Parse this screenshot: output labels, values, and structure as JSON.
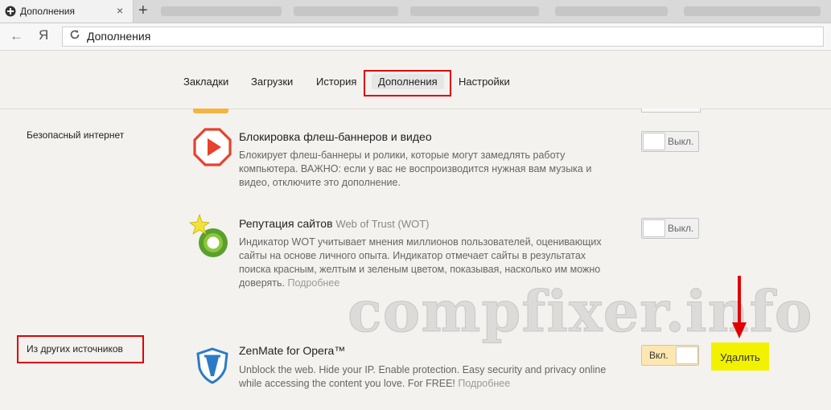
{
  "tab": {
    "title": "Дополнения",
    "close": "×",
    "new_tab": "+"
  },
  "toolbar": {
    "back": "←",
    "yandex": "Я",
    "address": "Дополнения"
  },
  "nav": {
    "tabs": [
      {
        "label": "Закладки"
      },
      {
        "label": "Загрузки"
      },
      {
        "label": "История"
      },
      {
        "label": "Дополнения",
        "active": true
      },
      {
        "label": "Настройки"
      }
    ]
  },
  "sections": {
    "safe_internet": "Безопасный интернет",
    "other_sources": "Из других источников"
  },
  "extensions": [
    {
      "name": "Блокировка флеш-баннеров и видео",
      "subtitle": "",
      "description": "Блокирует флеш-баннеры и ролики, которые могут замедлять работу компьютера. ВАЖНО: если у вас не воспроизводится нужная вам музыка и видео, отключите это дополнение.",
      "more": "",
      "toggle": "Выкл.",
      "enabled": false,
      "icon": "flash-block-icon"
    },
    {
      "name": "Репутация сайтов",
      "subtitle": "Web of Trust (WOT)",
      "description": "Индикатор WOT учитывает мнения миллионов пользователей, оценивающих сайты на основе личного опыта. Индикатор отмечает сайты в результатах поиска красным, желтым и зеленым цветом, показывая, насколько им можно доверять.",
      "more": "Подробнее",
      "toggle": "Выкл.",
      "enabled": false,
      "icon": "wot-icon"
    },
    {
      "name": "ZenMate for Opera™",
      "subtitle": "",
      "description": "Unblock the web. Hide your IP. Enable protection. Easy security and privacy online while accessing the content you love. For FREE!",
      "more": "Подробнее",
      "toggle": "Вкл.",
      "enabled": true,
      "icon": "zenmate-shield-icon",
      "delete_label": "Удалить"
    }
  ],
  "watermark": "compfixer.info",
  "colors": {
    "highlight_red": "#e00000",
    "delete_yellow": "#f2f200",
    "toggle_on": "#fde7b0"
  }
}
